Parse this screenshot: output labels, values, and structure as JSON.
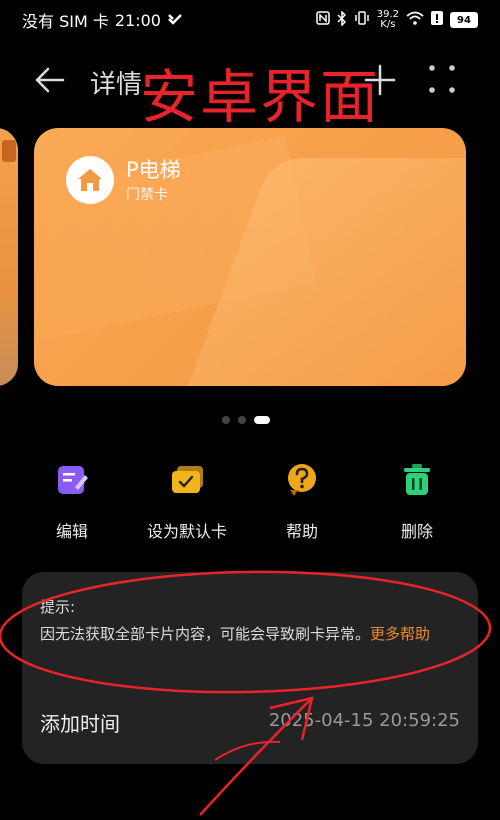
{
  "status_bar": {
    "carrier": "没有 SIM 卡",
    "time": "21:00",
    "net_speed_value": "39.2",
    "net_speed_unit": "K/s",
    "battery": "94"
  },
  "header": {
    "title": "详情",
    "overlay_text": "安卓界面",
    "back_icon": "back-arrow-icon",
    "add_icon": "plus-icon",
    "more_icon": "more-dots-icon"
  },
  "card": {
    "name": "P电梯",
    "type": "门禁卡",
    "icon": "home-icon",
    "color": "#f7a04a"
  },
  "pager": {
    "count": 3,
    "active": 2
  },
  "actions": [
    {
      "label": "编辑",
      "icon": "edit-icon",
      "color": "#8a5cf5"
    },
    {
      "label": "设为默认卡",
      "icon": "default-card-icon",
      "color": "#f0b619"
    },
    {
      "label": "帮助",
      "icon": "help-icon",
      "color": "#f0a61a"
    },
    {
      "label": "删除",
      "icon": "delete-icon",
      "color": "#2fd07a"
    }
  ],
  "info_panel": {
    "tip_title": "提示:",
    "tip_body": "因无法获取全部卡片内容，可能会导致刷卡异常。",
    "tip_link": "更多帮助",
    "added_label": "添加时间",
    "added_value": "2025-04-15 20:59:25"
  },
  "colors": {
    "background": "#000000",
    "panel": "#232323",
    "link": "#f08a2a",
    "annotation": "#e8242a"
  }
}
